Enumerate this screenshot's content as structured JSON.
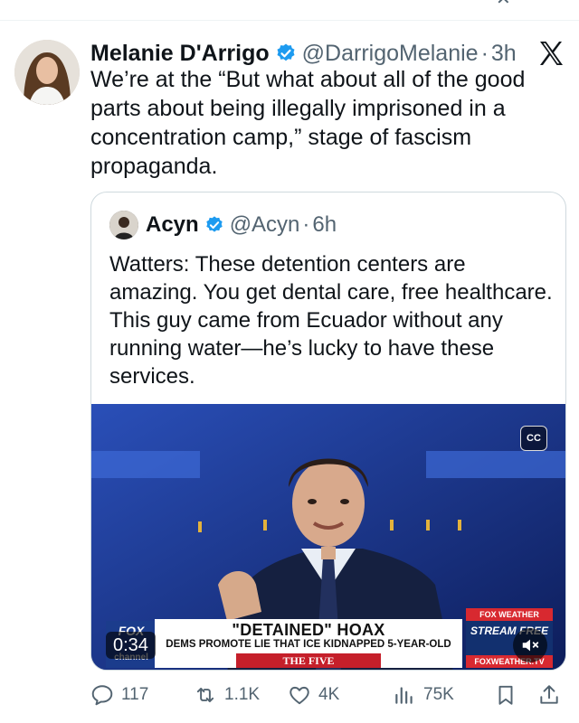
{
  "tweet": {
    "display_name": "Melanie D'Arrigo",
    "handle": "@DarrigoMelanie",
    "separator": "·",
    "time": "3h",
    "text": "We’re at the “But what about all of the good parts about being illegally imprisoned in a concentration camp,” stage of fascism propaganda."
  },
  "quote": {
    "display_name": "Acyn",
    "handle": "@Acyn",
    "separator": "·",
    "time": "6h",
    "text": "Watters: These detention centers are amazing. You get dental care, free healthcare. This guy came from Ecuador without any running water—he’s lucky to have these services.",
    "video": {
      "duration": "0:34",
      "cc_label": "CC",
      "headline": "\"DETAINED\" HOAX",
      "subheadline": "DEMS PROMOTE LIE THAT ICE KIDNAPPED 5-YEAR-OLD",
      "show_name": "THE FIVE",
      "network_logo": "FOX",
      "network_sub": "channel",
      "weather_top": "FOX WEATHER",
      "weather_mid": "STREAM FREE",
      "weather_bottom": "FOXWEATHER.TV"
    }
  },
  "actions": {
    "replies": "117",
    "reposts": "1.1K",
    "likes": "4K",
    "views": "75K"
  },
  "icons": [
    "verified-badge-icon",
    "x-logo-icon",
    "reply-icon",
    "repost-icon",
    "like-icon",
    "views-icon",
    "bookmark-icon",
    "share-icon",
    "closed-captions-icon",
    "mute-icon"
  ],
  "colors": {
    "verified": "#1d9bf0",
    "secondary_text": "#536471",
    "border": "#cfd9de"
  }
}
